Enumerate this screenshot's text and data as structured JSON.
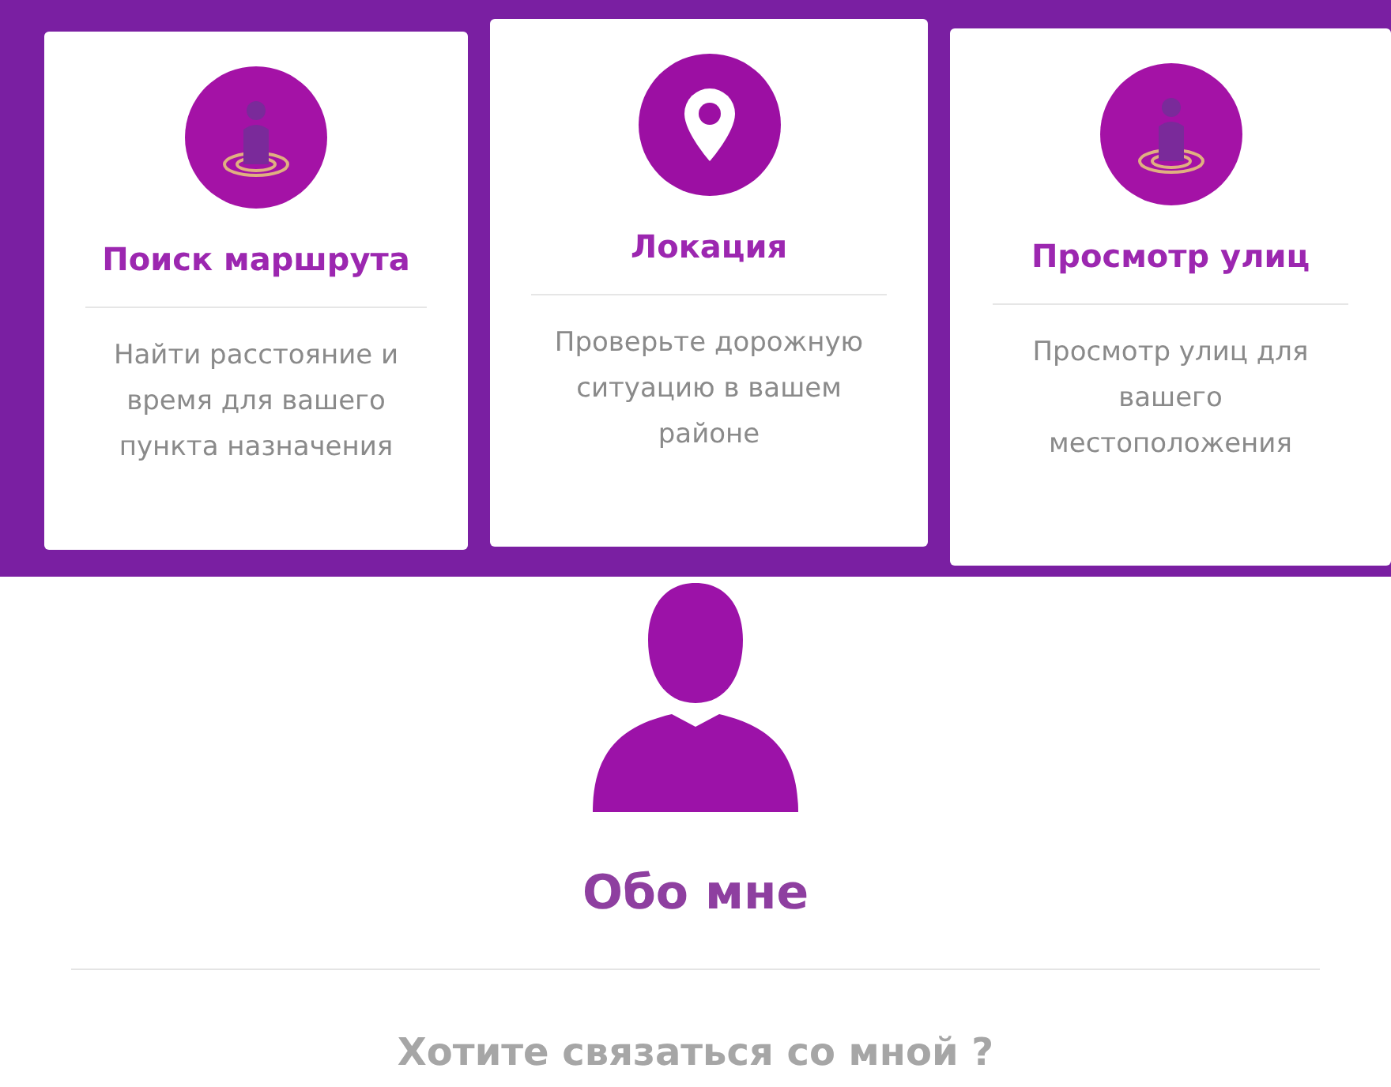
{
  "cards": [
    {
      "kind": "person-target",
      "title": "Поиск маршрута",
      "description": "Найти расстояние и время для вашего пункта назначения"
    },
    {
      "kind": "pin",
      "title": "Локация",
      "description": "Проверьте дорожную ситуацию в вашем районе"
    },
    {
      "kind": "person-target",
      "title": "Просмотр улиц",
      "description": "Просмотр улиц для вашего местоположения"
    }
  ],
  "about": {
    "title": "Обо мне"
  },
  "contact": {
    "text": "Хотите связаться со мной ?"
  }
}
